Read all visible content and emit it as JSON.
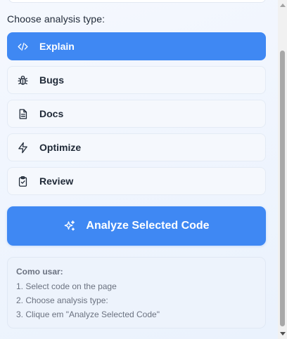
{
  "section_label": "Choose analysis type:",
  "options": [
    {
      "label": "Explain",
      "icon": "code-icon",
      "active": true
    },
    {
      "label": "Bugs",
      "icon": "bug-icon",
      "active": false
    },
    {
      "label": "Docs",
      "icon": "document-icon",
      "active": false
    },
    {
      "label": "Optimize",
      "icon": "lightning-icon",
      "active": false
    },
    {
      "label": "Review",
      "icon": "clipboard-check-icon",
      "active": false
    }
  ],
  "analyze_button": {
    "label": "Analyze Selected Code",
    "icon": "sparkles-icon"
  },
  "howto": {
    "title": "Como usar:",
    "steps": [
      "1. Select code on the page",
      "2. Choose analysis type:",
      "3. Clique em \"Analyze Selected Code\""
    ]
  },
  "colors": {
    "accent": "#3f88f3",
    "background": "#eef4fd",
    "text": "#1f2937",
    "muted": "#6b7280"
  }
}
